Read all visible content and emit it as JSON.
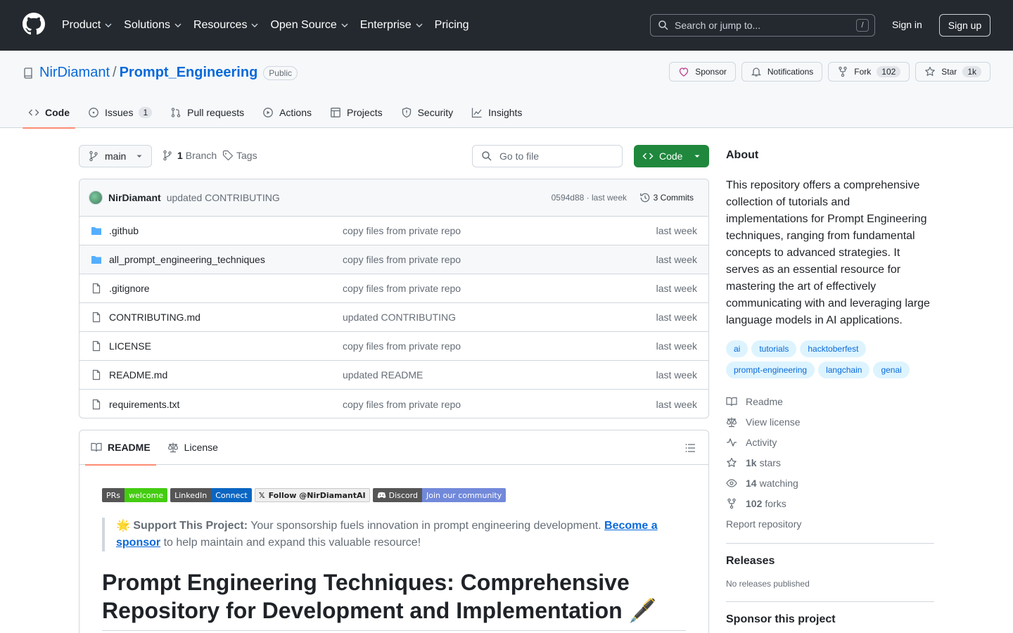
{
  "header": {
    "nav": [
      "Product",
      "Solutions",
      "Resources",
      "Open Source",
      "Enterprise",
      "Pricing"
    ],
    "nav_dropdown": [
      true,
      true,
      true,
      true,
      true,
      false
    ],
    "search_placeholder": "Search or jump to...",
    "search_shortcut": "/",
    "signin": "Sign in",
    "signup": "Sign up"
  },
  "repo": {
    "owner": "NirDiamant",
    "separator": "/",
    "name": "Prompt_Engineering",
    "visibility": "Public",
    "actions": {
      "sponsor": "Sponsor",
      "notifications": "Notifications",
      "fork": "Fork",
      "fork_count": "102",
      "star": "Star",
      "star_count": "1k"
    },
    "tabs": [
      {
        "label": "Code",
        "icon": "code-icon"
      },
      {
        "label": "Issues",
        "icon": "issue-icon",
        "count": "1"
      },
      {
        "label": "Pull requests",
        "icon": "pull-request-icon"
      },
      {
        "label": "Actions",
        "icon": "play-icon"
      },
      {
        "label": "Projects",
        "icon": "table-icon"
      },
      {
        "label": "Security",
        "icon": "shield-icon"
      },
      {
        "label": "Insights",
        "icon": "graph-icon"
      }
    ]
  },
  "filenav": {
    "branch": "main",
    "branch_count": "1",
    "branch_label": "Branch",
    "tags_label": "Tags",
    "goto_placeholder": "Go to file",
    "code_button": "Code"
  },
  "commit": {
    "author": "NirDiamant",
    "message": "updated CONTRIBUTING",
    "meta": "0594d88 · last week",
    "count": "3 Commits"
  },
  "files": [
    {
      "name": ".github",
      "type": "folder",
      "commit": "copy files from private repo",
      "date": "last week"
    },
    {
      "name": "all_prompt_engineering_techniques",
      "type": "folder",
      "commit": "copy files from private repo",
      "date": "last week"
    },
    {
      "name": ".gitignore",
      "type": "file",
      "commit": "copy files from private repo",
      "date": "last week"
    },
    {
      "name": "CONTRIBUTING.md",
      "type": "file",
      "commit": "updated CONTRIBUTING",
      "date": "last week"
    },
    {
      "name": "LICENSE",
      "type": "file",
      "commit": "copy files from private repo",
      "date": "last week"
    },
    {
      "name": "README.md",
      "type": "file",
      "commit": "updated README",
      "date": "last week"
    },
    {
      "name": "requirements.txt",
      "type": "file",
      "commit": "copy files from private repo",
      "date": "last week"
    }
  ],
  "readme": {
    "tab_readme": "README",
    "tab_license": "License",
    "badges": [
      {
        "left": "PRs",
        "right": "welcome",
        "color": "#4c1"
      },
      {
        "left": "LinkedIn",
        "right": "Connect",
        "color": "#0a66c2"
      },
      {
        "left": "Discord",
        "right": "Join our community",
        "color": "#7289da"
      }
    ],
    "badge_x_logo": "𝕏",
    "badge_x": "Follow @NirDiamantAI",
    "quote_emoji": "🌟",
    "quote_bold": "Support This Project:",
    "quote_text": " Your sponsorship fuels innovation in prompt engineering development. ",
    "quote_link": "Become a sponsor",
    "quote_tail": " to help maintain and expand this valuable resource!",
    "heading": "Prompt Engineering Techniques: Comprehensive Repository for Development and Implementation 🖋️"
  },
  "sidebar": {
    "about_title": "About",
    "about_text": "This repository offers a comprehensive collection of tutorials and implementations for Prompt Engineering techniques, ranging from fundamental concepts to advanced strategies. It serves as an essential resource for mastering the art of effectively communicating with and leveraging large language models in AI applications.",
    "topics": [
      "ai",
      "tutorials",
      "hacktoberfest",
      "prompt-engineering",
      "langchain",
      "genai"
    ],
    "readme": "Readme",
    "license": "View license",
    "activity": "Activity",
    "stars_count": "1k",
    "stars_label": "stars",
    "watching_count": "14",
    "watching_label": "watching",
    "forks_count": "102",
    "forks_label": "forks",
    "report": "Report repository",
    "releases_title": "Releases",
    "releases_text": "No releases published",
    "sponsor_title": "Sponsor this project"
  }
}
